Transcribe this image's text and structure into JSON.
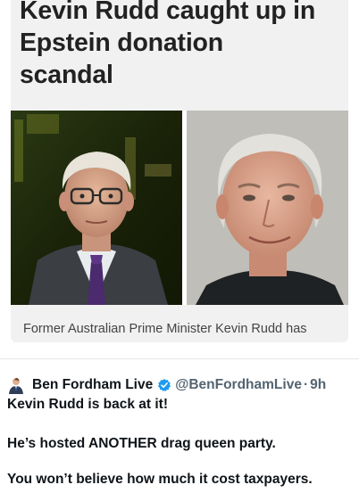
{
  "article": {
    "headline_line1": "Kevin Rudd caught up in",
    "headline_line2": "Epstein donation",
    "headline_line3": "scandal",
    "caption": "Former Australian Prime Minister Kevin Rudd has"
  },
  "tweet": {
    "author_name": "Ben Fordham Live",
    "handle": "@BenFordhamLive",
    "separator": "·",
    "time": "9h",
    "line1": "Kevin Rudd is back at it!",
    "line2": "He’s hosted ANOTHER drag queen party.",
    "line3": "You won’t believe how much it cost taxpayers."
  },
  "colors": {
    "verified_badge": "#1d9bf0",
    "handle_gray": "#536471",
    "card_background": "#f1f1f1"
  }
}
